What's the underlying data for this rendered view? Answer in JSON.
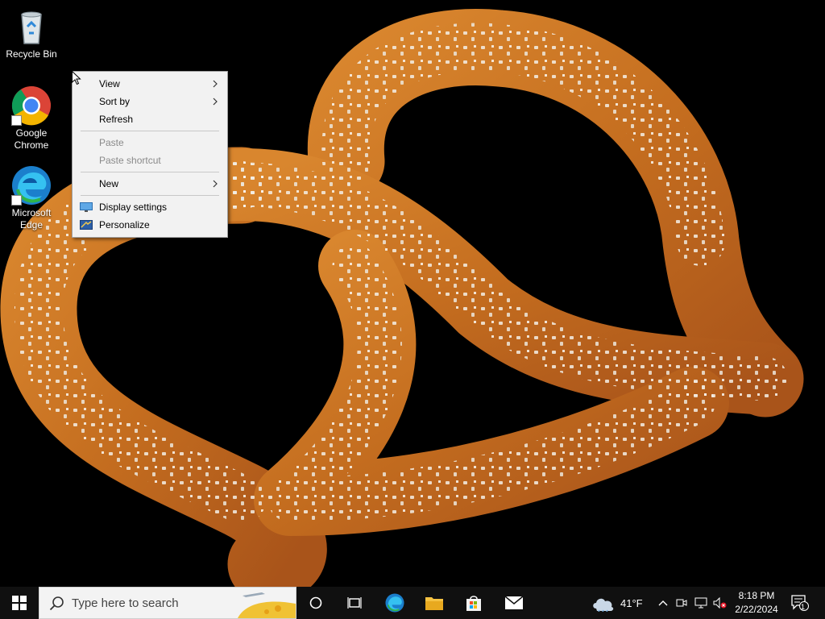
{
  "desktop_icons": [
    {
      "label": "Recycle Bin",
      "icon": "recycle-bin-icon"
    },
    {
      "label_line1": "Google",
      "label_line2": "Chrome",
      "icon": "chrome-icon"
    },
    {
      "label_line1": "Microsoft",
      "label_line2": "Edge",
      "icon": "edge-icon"
    }
  ],
  "context_menu": {
    "items": [
      {
        "label": "View",
        "submenu": true
      },
      {
        "label": "Sort by",
        "submenu": true
      },
      {
        "label": "Refresh"
      },
      {
        "label": "Paste",
        "disabled": true
      },
      {
        "label": "Paste shortcut",
        "disabled": true
      },
      {
        "label": "New",
        "submenu": true
      },
      {
        "label": "Display settings",
        "icon": "display-icon"
      },
      {
        "label": "Personalize",
        "icon": "personalize-icon"
      }
    ]
  },
  "taskbar": {
    "search_placeholder": "Type here to search",
    "pinned": [
      "start-icon",
      "cortana-icon",
      "task-view-icon",
      "edge-icon",
      "file-explorer-icon",
      "store-icon",
      "mail-icon"
    ],
    "weather": "41°F",
    "time": "8:18 PM",
    "date": "2/22/2024",
    "notification_count": "1"
  },
  "colors": {
    "taskbar_bg": "#101010",
    "menu_bg": "#f2f2f2",
    "desktop_bg": "#000000"
  }
}
